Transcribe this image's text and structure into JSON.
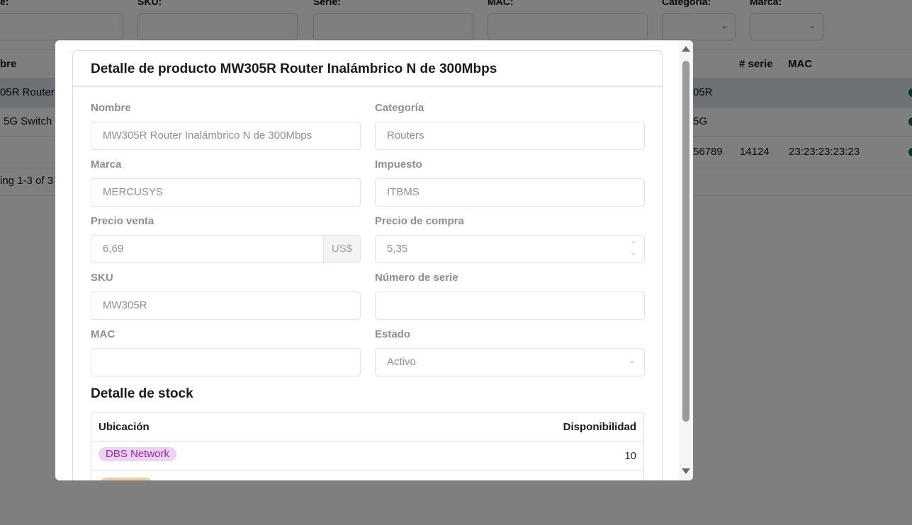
{
  "background": {
    "filters": [
      {
        "label": "e:"
      },
      {
        "label": "SKU:"
      },
      {
        "label": "Serie:"
      },
      {
        "label": "MAC:"
      },
      {
        "label": "Categoría:"
      },
      {
        "label": "Marca:"
      }
    ],
    "table": {
      "headers": {
        "name": "bre",
        "serie": "# serie",
        "mac": "MAC"
      },
      "rows": [
        {
          "name": "05R Router",
          "sku": "05R",
          "serie": "",
          "mac": ""
        },
        {
          "name": "5G Switch",
          "sku": "5G",
          "serie": "",
          "mac": ""
        },
        {
          "name": "",
          "sku": "56789",
          "serie": "14124",
          "mac": "23:23:23:23:23"
        }
      ],
      "footer": "ing 1-3 of 3"
    }
  },
  "modal": {
    "title": "Detalle de producto MW305R Router Inalámbrico N de 300Mbps",
    "fields": {
      "nombre": {
        "label": "Nombre",
        "value": "MW305R Router Inalámbrico N de 300Mbps"
      },
      "categoria": {
        "label": "Categoría",
        "value": "Routers"
      },
      "marca": {
        "label": "Marca",
        "value": "MERCUSYS"
      },
      "impuesto": {
        "label": "Impuesto",
        "value": "ITBMS"
      },
      "precio_venta": {
        "label": "Precio venta",
        "value": "6,69",
        "currency": "US$"
      },
      "precio_compra": {
        "label": "Precio de compra",
        "value": "5,35"
      },
      "sku": {
        "label": "SKU",
        "value": "MW305R"
      },
      "numero_serie": {
        "label": "Número de serie",
        "value": ""
      },
      "mac": {
        "label": "MAC",
        "value": ""
      },
      "estado": {
        "label": "Estado",
        "value": "Activo"
      }
    },
    "stock": {
      "title": "Detalle de stock",
      "headers": {
        "location": "Ubicación",
        "availability": "Disponibilidad"
      },
      "rows": [
        {
          "location": "DBS Network",
          "availability": "10"
        }
      ]
    }
  },
  "colors": {
    "badge_bg": "#ecd2f4",
    "badge_text": "#8a2e9e",
    "status_green": "#0b6b4f"
  }
}
